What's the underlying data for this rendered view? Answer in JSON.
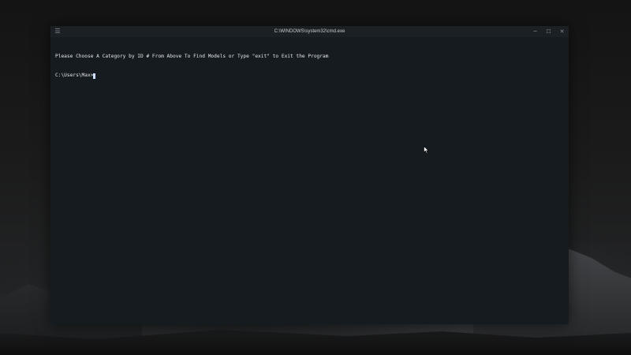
{
  "window": {
    "title": "C:\\WINDOWS\\system32\\cmd.exe",
    "controls": {
      "menu": "☰",
      "minimize": "─",
      "maximize": "☐",
      "close": "✕"
    }
  },
  "terminal": {
    "lines": [
      "Please Choose A Category by ID # From Above To Find Models or Type \"exit\" to Exit the Program"
    ],
    "prompt": "C:\\Users\\Max>",
    "input": ""
  },
  "colors": {
    "terminal_bg": "#161b1f",
    "text": "#e4e7ea",
    "cursor": "#cfe0ff"
  },
  "icons": {
    "menu": "hamburger-icon",
    "minimize": "minimize-icon",
    "maximize": "maximize-icon",
    "close": "close-icon",
    "pointer": "mouse-pointer-icon"
  }
}
